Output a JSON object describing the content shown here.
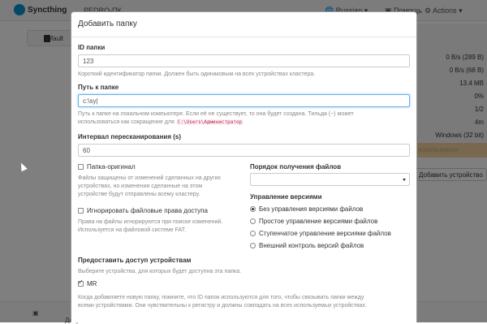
{
  "navbar": {
    "brand": "Syncthing",
    "device": "PEDRO-ПК",
    "language": "Russian",
    "help": "Помощь",
    "actions": "Actions"
  },
  "background": {
    "folder_label": "default",
    "values": [
      "0 B/s (289 B)",
      "0 B/s (68 B)",
      "13.4 MB",
      "0%",
      "1/2",
      "4m",
      "Windows (32 bit)"
    ],
    "warning": "используется",
    "add_device": "Добавить устройство",
    "footer": "Документ"
  },
  "modal": {
    "title": "Добавить папку",
    "folder_id": {
      "label": "ID папки",
      "value": "123",
      "help": "Короткий идентификатор папки. Должен быть одинаковым на всех устройствах кластера."
    },
    "folder_path": {
      "label": "Путь к папке",
      "value": "c:\\sy|",
      "help1": "Путь к папке на локальном компьютере. Если её не существует, то она будет создана. Тильда (~) может",
      "help2": "использоваться как сокращение для",
      "code": "C:\\Users\\Администратор"
    },
    "rescan": {
      "label": "Интервал пересканирования (s)",
      "value": "60"
    },
    "master": {
      "label": "Папка-оригинал",
      "checked": false,
      "help": [
        "Файлы защищены от изменений сделанных на других",
        "устройствах, но изменения сделанные на этом",
        "устройстве будут отправлены всему кластеру."
      ]
    },
    "ignore_perms": {
      "label": "Игнорировать файловые права доступа",
      "checked": false,
      "help": [
        "Права на файлы игнорируются при поиске изменений.",
        "Используется на файловой системе FAT."
      ]
    },
    "pull_order": {
      "label": "Порядок получения файлов",
      "value": ""
    },
    "versioning": {
      "label": "Управление версиями",
      "options": [
        {
          "label": "Без управления версиями файлов",
          "checked": true
        },
        {
          "label": "Простое управление версиями файлов",
          "checked": false
        },
        {
          "label": "Ступенчатое управление версиями файлов",
          "checked": false
        },
        {
          "label": "Внешний контроль версий файлов",
          "checked": false
        }
      ]
    },
    "share": {
      "label": "Предоставить доступ устройствам",
      "help": "Выберите устройства, для которых будет доступна эта папка.",
      "device": "MR",
      "device_checked": true
    },
    "footer_note": [
      "Когда добавляете новую папку, помните, что ID папок используются для того, чтобы связывать папки между",
      "всеми устройствами. Они чувствительны к регистру и должны совпадать на всех используемых устройствах."
    ]
  },
  "colors": {
    "accent": "#66afe9",
    "code_text": "#c7254e",
    "brand_blue": "#0891d1",
    "warning": "#f0ad4e"
  }
}
